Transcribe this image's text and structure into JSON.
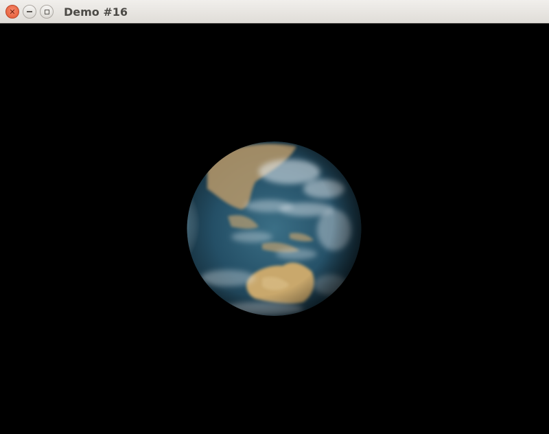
{
  "window": {
    "title": "Demo #16",
    "controls": {
      "close": "close-icon",
      "minimize": "minimize-icon",
      "maximize": "maximize-icon"
    }
  },
  "scene": {
    "background": "#000000",
    "object": "earth-globe",
    "ocean_color": "#1f4f66",
    "land_color": "#c9a66a",
    "highlight_color": "#ffffff"
  }
}
